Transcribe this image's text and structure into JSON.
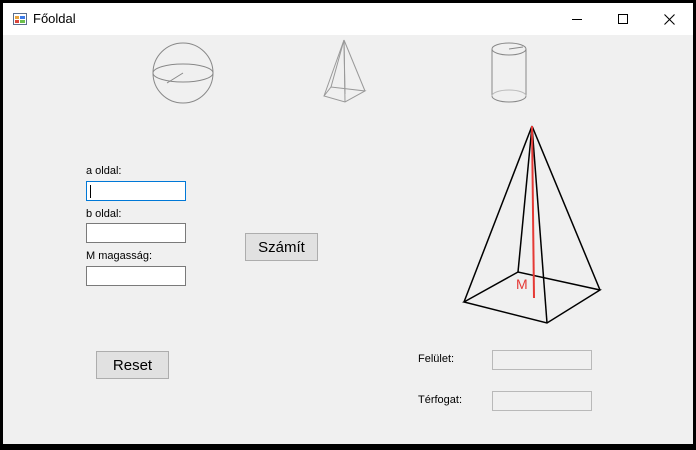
{
  "window": {
    "title": "Főoldal"
  },
  "titlebar": {
    "icon": "winforms-app-icon",
    "minimize_icon": "minimize-icon",
    "maximize_icon": "maximize-icon",
    "close_icon": "close-icon"
  },
  "shapes": [
    "sphere-icon",
    "pyramid-icon",
    "cylinder-icon"
  ],
  "form": {
    "a_label": "a oldal:",
    "a_value": "",
    "b_label": "b oldal:",
    "b_value": "",
    "m_label": "M magasság:",
    "m_value": ""
  },
  "buttons": {
    "calculate": "Számít",
    "reset": "Reset"
  },
  "diagram": {
    "height_marker": "M",
    "height_color": "#e53935"
  },
  "results": {
    "surface_label": "Felület:",
    "surface_value": "",
    "volume_label": "Térfogat:",
    "volume_value": ""
  }
}
